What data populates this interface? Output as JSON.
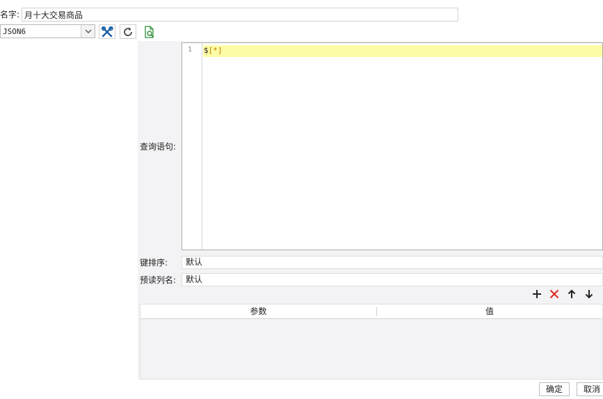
{
  "name_row": {
    "label": "名字:",
    "value": "月十大交易商品"
  },
  "toolbar": {
    "dataset_select": "JSON6",
    "edit_icon": "tools-icon",
    "refresh_icon": "refresh-icon",
    "preview_icon": "file-search-icon"
  },
  "query": {
    "label": "查询语句:",
    "line_number": "1",
    "code": {
      "dollar": "$",
      "open": "[",
      "star": "*",
      "close": "]"
    }
  },
  "sort": {
    "label": "键排序:",
    "value": "默认"
  },
  "preread": {
    "label": "预读列名:",
    "value": "默认"
  },
  "param_tools": [
    "add-icon",
    "delete-icon",
    "arrow-up-icon",
    "arrow-down-icon"
  ],
  "param_table": {
    "col_param": "参数",
    "col_value": "值",
    "rows": []
  },
  "footer": {
    "ok": "确定",
    "cancel": "取消"
  },
  "colors": {
    "line_highlight": "#fdfca6",
    "bracket": "#c27d00",
    "delete": "#e0302a",
    "edit_icon": "#1d5fa8",
    "preview_icon": "#2f8f3a"
  }
}
